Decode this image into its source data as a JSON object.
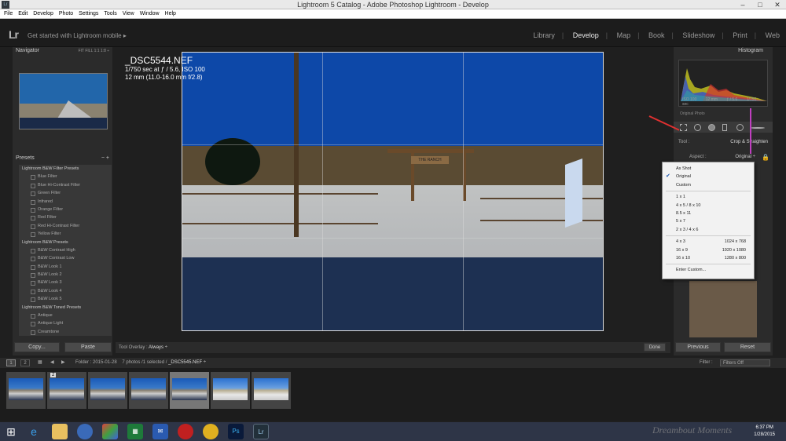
{
  "window": {
    "title": "Lightroom 5 Catalog - Adobe Photoshop Lightroom - Develop",
    "app_icon": "Lr"
  },
  "menu": [
    "File",
    "Edit",
    "Develop",
    "Photo",
    "Settings",
    "Tools",
    "View",
    "Window",
    "Help"
  ],
  "identity": {
    "logo": "Lr",
    "mobile_text": "Get started with Lightroom mobile ▸"
  },
  "modules": [
    {
      "label": "Library",
      "active": false
    },
    {
      "label": "Develop",
      "active": true
    },
    {
      "label": "Map",
      "active": false
    },
    {
      "label": "Book",
      "active": false
    },
    {
      "label": "Slideshow",
      "active": false
    },
    {
      "label": "Print",
      "active": false
    },
    {
      "label": "Web",
      "active": false
    }
  ],
  "navigator": {
    "title": "Navigator",
    "zooms": "FIT  FILL  1:1  1:8 ÷"
  },
  "presets": {
    "title": "Presets",
    "plus_minus": "− +",
    "groups": [
      {
        "label": "Lightroom B&W Filter Presets",
        "items": [
          "Blue Filter",
          "Blue Hi-Contrast Filter",
          "Green Filter",
          "Infrared",
          "Orange Filter",
          "Red Filter",
          "Red Hi-Contrast Filter",
          "Yellow Filter"
        ]
      },
      {
        "label": "Lightroom B&W Presets",
        "items": [
          "B&W Contrast High",
          "B&W Contrast Low",
          "B&W Look 1",
          "B&W Look 2",
          "B&W Look 3",
          "B&W Look 4",
          "B&W Look 5"
        ]
      },
      {
        "label": "Lightroom B&W Toned Presets",
        "items": [
          "Antique",
          "Antique Light",
          "Creamtone"
        ]
      }
    ]
  },
  "left_buttons": {
    "copy": "Copy...",
    "paste": "Paste"
  },
  "photo": {
    "filename": "_DSC5544.NEF",
    "exposure": "1/750 sec at ƒ / 5.6, ISO 100",
    "lens": "12 mm (11.0-16.0 mm f/2.8)",
    "sign_text": "THE RANCH"
  },
  "toolbar": {
    "tool_overlay_label": "Tool Overlay :",
    "tool_overlay_value": "Always ÷",
    "done": "Done"
  },
  "histogram": {
    "title": "Histogram",
    "iso": "ISO 100",
    "focal": "12 mm",
    "aperture": "ƒ / 5.6",
    "shutter": "1/750 sec",
    "original_photo": "Original Photo"
  },
  "crop": {
    "tool_label": "Tool :",
    "tool_name": "Crop & Straighten",
    "aspect_label": "Aspect :",
    "aspect_value": "Original ÷"
  },
  "aspect_menu": {
    "items": [
      {
        "label": "As Shot",
        "right": "",
        "checked": false
      },
      {
        "label": "Original",
        "right": "",
        "checked": true
      },
      {
        "label": "Custom",
        "right": "",
        "checked": false
      }
    ],
    "ratios1": [
      "1 x 1",
      "4 x 5  /  8 x 10",
      "8.5 x 11",
      "5 x 7",
      "2 x 3  /  4 x 6"
    ],
    "ratios2": [
      {
        "label": "4 x 3",
        "right": "1024 x 768"
      },
      {
        "label": "16 x 9",
        "right": "1920 x 1080"
      },
      {
        "label": "16 x 10",
        "right": "1280 x 800"
      }
    ],
    "custom": "Enter Custom..."
  },
  "right_buttons": {
    "previous": "Previous",
    "reset": "Reset"
  },
  "filmstrip_bar": {
    "view1": "1",
    "view2": "2",
    "folder": "Folder : 2015-01-28",
    "count": "7 photos /1 selected /",
    "current": "_DSC5545.NEF ÷",
    "filter_label": "Filter :",
    "filter_value": "Filters Off"
  },
  "filmstrip": {
    "badge": "2",
    "selected_index": 4
  },
  "taskbar": {
    "time": "6:37 PM",
    "date": "1/28/2015",
    "watermark": "Dreambout Moments"
  },
  "colors": {
    "accent_red": "#e03030",
    "accent_magenta": "#c040c0",
    "check": "#1a56b0"
  }
}
